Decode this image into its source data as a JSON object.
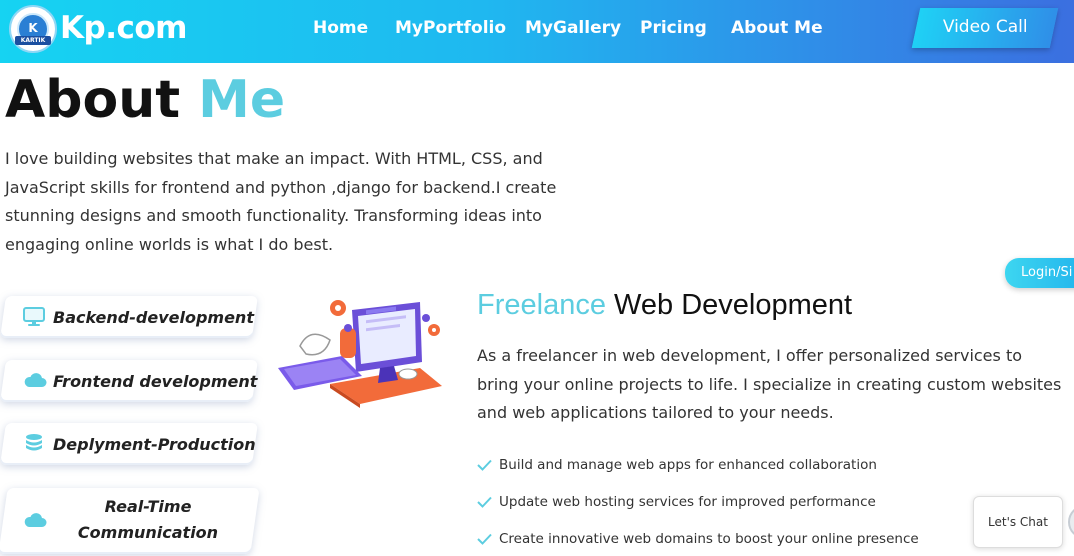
{
  "navbar": {
    "logo_text": "KARTIK",
    "logo_initial": "K",
    "brand": "Kp.com",
    "links": [
      "Home",
      "MyPortfolio",
      "MyGallery",
      "Pricing",
      "About Me"
    ],
    "cta_label": "Video Call"
  },
  "about": {
    "title_main": "About ",
    "title_accent": "Me",
    "paragraph": "I love building websites that make an impact. With HTML, CSS, and JavaScript skills for frontend and python ,django for backend.I create stunning designs and smooth functionality. Transforming ideas into engaging online worlds is what I do best."
  },
  "login_tab": {
    "label": "Login/Si"
  },
  "skills": [
    {
      "label": "Backend-development",
      "icon": "monitor-icon"
    },
    {
      "label": "Frontend development",
      "icon": "cloud-icon"
    },
    {
      "label": "Deplyment-Production",
      "icon": "database-icon"
    },
    {
      "label": "Real-Time Communication",
      "icon": "cloud-icon"
    }
  ],
  "freelance": {
    "title_accent": "Freelance",
    "title_main": " Web Development",
    "paragraph": "As a freelancer in web development, I offer personalized services to bring your online projects to life. I specialize in creating custom websites and web applications tailored to your needs.",
    "items": [
      "Build and manage web apps for enhanced collaboration",
      "Update web hosting services for improved performance",
      "Create innovative web domains to boost your online presence"
    ]
  },
  "chat": {
    "label": "Let's Chat"
  },
  "colors": {
    "accent": "#5ccde0",
    "nav_start": "#16d3f2",
    "nav_end": "#3b6fe0",
    "check": "#5ccde0"
  }
}
